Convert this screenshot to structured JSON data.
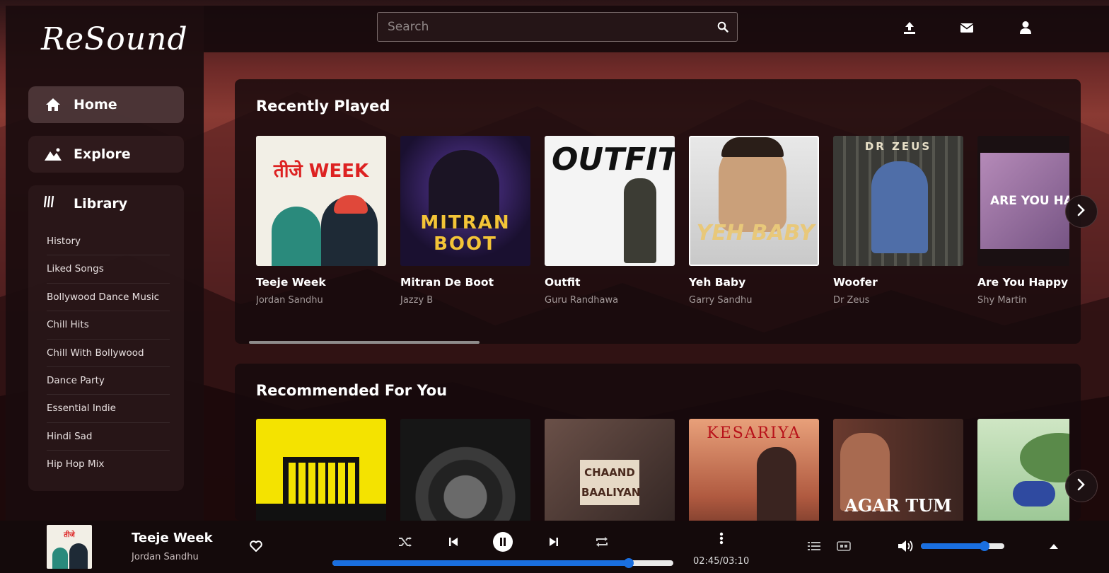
{
  "app": {
    "logo_text": "ReSound"
  },
  "sidebar": {
    "items": [
      {
        "label": "Home",
        "icon": "home-icon",
        "active": true
      },
      {
        "label": "Explore",
        "icon": "mountain-icon",
        "active": false
      }
    ],
    "library": {
      "label": "Library",
      "icon": "library-icon",
      "playlists": [
        "History",
        "Liked Songs",
        "Bollywood Dance Music",
        "Chill Hits",
        "Chill With Bollywood",
        "Dance Party",
        "Essential Indie",
        "Hindi Sad",
        "Hip Hop Mix"
      ]
    }
  },
  "topbar": {
    "search_placeholder": "Search",
    "icons": [
      "upload-icon",
      "mail-icon",
      "user-icon"
    ]
  },
  "recently_played": {
    "title": "Recently Played",
    "cards": [
      {
        "title": "Teeje Week",
        "artist": "Jordan Sandhu",
        "art_text": "तीजे WEEK"
      },
      {
        "title": "Mitran De Boot",
        "artist": "Jazzy B",
        "art_text": "MITRAN BOOT"
      },
      {
        "title": "Outfit",
        "artist": "Guru Randhawa",
        "art_text": "OUTFIT"
      },
      {
        "title": "Yeh Baby",
        "artist": "Garry Sandhu",
        "art_text": "YEH BABY"
      },
      {
        "title": "Woofer",
        "artist": "Dr Zeus",
        "art_text": "DR ZEUS"
      },
      {
        "title": "Are You Happy",
        "artist": "Shy Martin",
        "art_text": "ARE YOU HA"
      }
    ]
  },
  "recommended": {
    "title": "Recommended For You",
    "cards": [
      {
        "art_text": ""
      },
      {
        "art_text": ""
      },
      {
        "art_text": "CHAAND BAALIYAN"
      },
      {
        "art_text": "KESARIYA"
      },
      {
        "art_text": "AGAR TUM"
      },
      {
        "art_text": ""
      }
    ]
  },
  "player": {
    "title": "Teeje Week",
    "artist": "Jordan Sandhu",
    "time": "02:45/03:10",
    "progress": 0.87,
    "volume": 0.76,
    "accent": "#1a6fe0"
  }
}
